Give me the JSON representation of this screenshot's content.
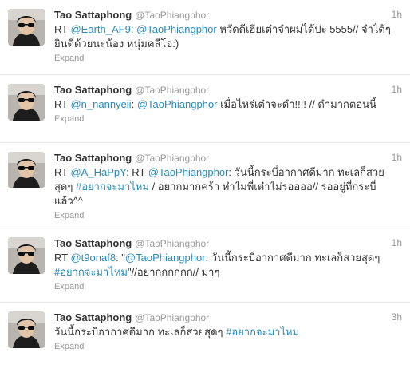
{
  "tweets": [
    {
      "name": "Tao Sattaphong",
      "handle": "@TaoPhiangphor",
      "time": "1h",
      "parts": [
        {
          "t": "RT ",
          "link": false
        },
        {
          "t": "@Earth_AF9",
          "link": true
        },
        {
          "t": ": ",
          "link": false
        },
        {
          "t": "@TaoPhiangphor",
          "link": true
        },
        {
          "t": " หวัดดีเฮียเต๋าจำผมได้ปะ 5555// จำได้ๆยินดีด้วยนะน้อง หนุ่มคลีโอ:)",
          "link": false
        }
      ],
      "expand": "Expand"
    },
    {
      "name": "Tao Sattaphong",
      "handle": "@TaoPhiangphor",
      "time": "1h",
      "parts": [
        {
          "t": "RT ",
          "link": false
        },
        {
          "t": "@n_nannyeii",
          "link": true
        },
        {
          "t": ": ",
          "link": false
        },
        {
          "t": "@TaoPhiangphor",
          "link": true
        },
        {
          "t": " เมื่อไหร่เต๋าจะดำ!!!! // ดำมากตอนนี้",
          "link": false
        }
      ],
      "expand": "Expand"
    },
    {
      "name": "Tao Sattaphong",
      "handle": "@TaoPhiangphor",
      "time": "1h",
      "parts": [
        {
          "t": "RT ",
          "link": false
        },
        {
          "t": "@A_HaPpY",
          "link": true
        },
        {
          "t": ": RT ",
          "link": false
        },
        {
          "t": "@TaoPhiangphor",
          "link": true
        },
        {
          "t": ": วันนี้กระบี่อากาศดีมาก ทะเลก็สวยสุดๆ ",
          "link": false
        },
        {
          "t": "#อยากจะมาไหม",
          "link": true
        },
        {
          "t": " / อยากมากคร้า ทำไมพี่เต๋าไม่รออออ// รออยู่ที่กระบี่แล้ว^^",
          "link": false
        }
      ],
      "expand": "Expand"
    },
    {
      "name": "Tao Sattaphong",
      "handle": "@TaoPhiangphor",
      "time": "1h",
      "parts": [
        {
          "t": "RT ",
          "link": false
        },
        {
          "t": "@t9onaf8",
          "link": true
        },
        {
          "t": ": \"",
          "link": false
        },
        {
          "t": "@TaoPhiangphor",
          "link": true
        },
        {
          "t": ": วันนี้กระบี่อากาศดีมาก ทะเลก็สวยสุดๆ ",
          "link": false
        },
        {
          "t": "#อยากจะมาไหม",
          "link": true
        },
        {
          "t": "\"//อยากกกกกก// มาๆ",
          "link": false
        }
      ],
      "expand": "Expand"
    },
    {
      "name": "Tao Sattaphong",
      "handle": "@TaoPhiangphor",
      "time": "3h",
      "parts": [
        {
          "t": "วันนี้กระบี่อากาศดีมาก ทะเลก็สวยสุดๆ ",
          "link": false
        },
        {
          "t": "#อยากจะมาไหม",
          "link": true
        }
      ],
      "expand": "Expand"
    }
  ],
  "colors": {
    "link": "#2a8ab8",
    "name": "#333333",
    "meta": "#999999",
    "divider": "#e8e8e8"
  },
  "icons": {
    "avatar": "profile-photo"
  }
}
